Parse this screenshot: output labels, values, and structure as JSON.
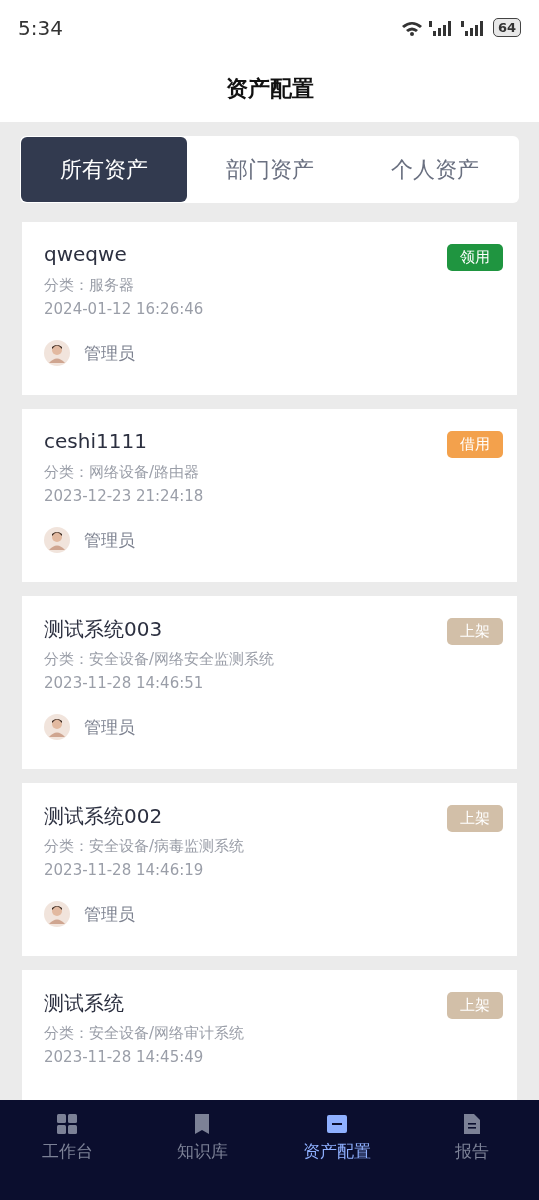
{
  "status_bar": {
    "time": "5:34",
    "battery": "64"
  },
  "header": {
    "title": "资产配置"
  },
  "tabs": [
    {
      "label": "所有资产",
      "selected": true
    },
    {
      "label": "部门资产",
      "selected": false
    },
    {
      "label": "个人资产",
      "selected": false
    }
  ],
  "assets": [
    {
      "name": "qweqwe",
      "category": "分类：服务器",
      "time": "2024-01-12 16:26:46",
      "owner": "管理员",
      "status": "领用",
      "color": "#1f9540"
    },
    {
      "name": "ceshi1111",
      "category": "分类：网络设备/路由器",
      "time": "2023-12-23 21:24:18",
      "owner": "管理员",
      "status": "借用",
      "color": "#f3a14c"
    },
    {
      "name": "测试系统003",
      "category": "分类：安全设备/网络安全监测系统",
      "time": "2023-11-28 14:46:51",
      "owner": "管理员",
      "status": "上架",
      "color": "#d2bfa8"
    },
    {
      "name": "测试系统002",
      "category": "分类：安全设备/病毒监测系统",
      "time": "2023-11-28 14:46:19",
      "owner": "管理员",
      "status": "上架",
      "color": "#d2bfa8"
    },
    {
      "name": "测试系统",
      "category": "分类：安全设备/网络审计系统",
      "time": "2023-11-28 14:45:49",
      "status": "上架",
      "color": "#d2bfa8"
    }
  ],
  "bottom_nav": [
    {
      "label": "工作台",
      "kind": "grid",
      "selected": false
    },
    {
      "label": "知识库",
      "kind": "bookmark",
      "selected": false
    },
    {
      "label": "资产配置",
      "kind": "asset",
      "selected": true
    },
    {
      "label": "报告",
      "kind": "document",
      "selected": false
    }
  ]
}
